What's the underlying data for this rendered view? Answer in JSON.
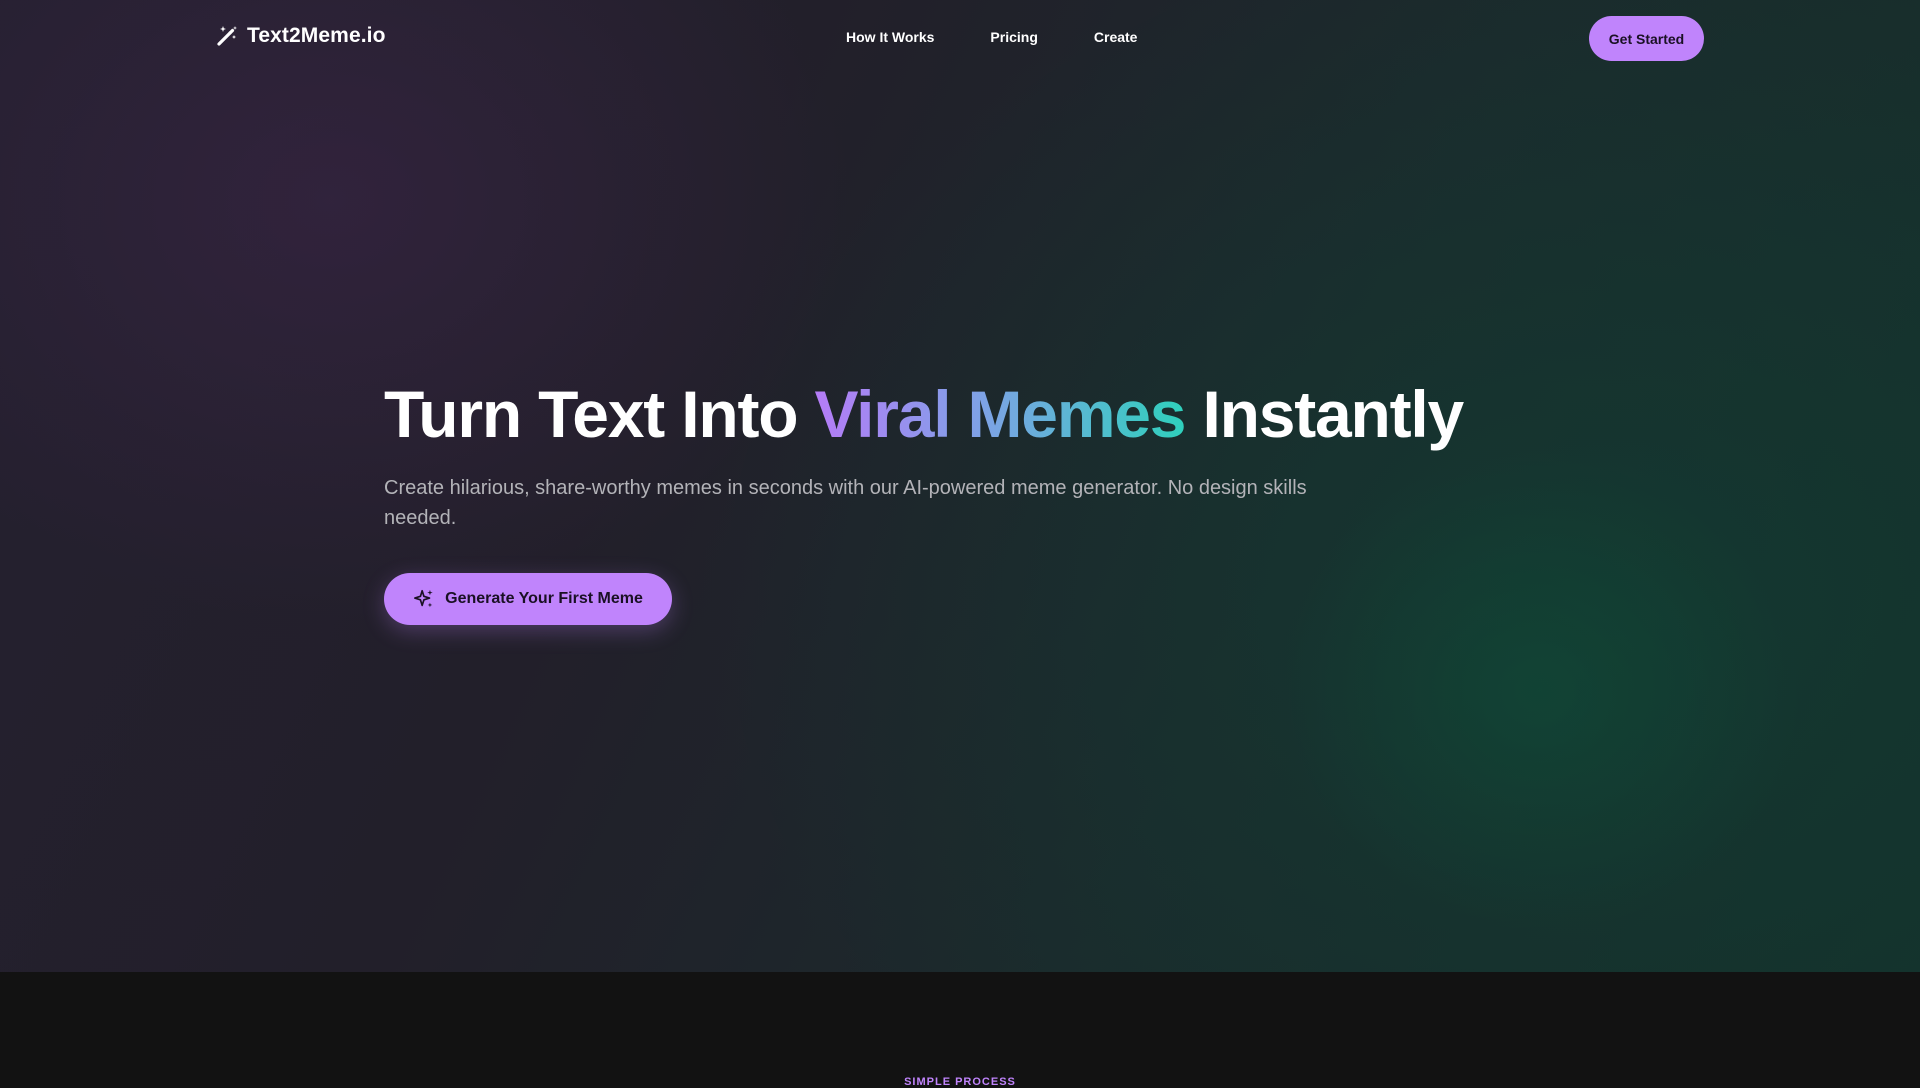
{
  "brand": {
    "name": "Text2Meme.io",
    "icon": "magic-wand-icon"
  },
  "nav": {
    "links": [
      "How It Works",
      "Pricing",
      "Create"
    ],
    "cta_label": "Get Started"
  },
  "hero": {
    "headline_before": "Turn Text Into ",
    "headline_highlight": "Viral Memes",
    "headline_after": " Instantly",
    "subtitle": "Create hilarious, share-worthy memes in seconds with our AI-powered meme generator. No design skills needed.",
    "cta_label": "Generate Your First Meme",
    "cta_icon": "sparkles-icon"
  },
  "next_section": {
    "eyebrow": "SIMPLE PROCESS"
  },
  "colors": {
    "accent": "#c084fc",
    "gradient_start": "#b57cf7",
    "gradient_end": "#2fd0bc",
    "footer_bg": "#121212"
  }
}
